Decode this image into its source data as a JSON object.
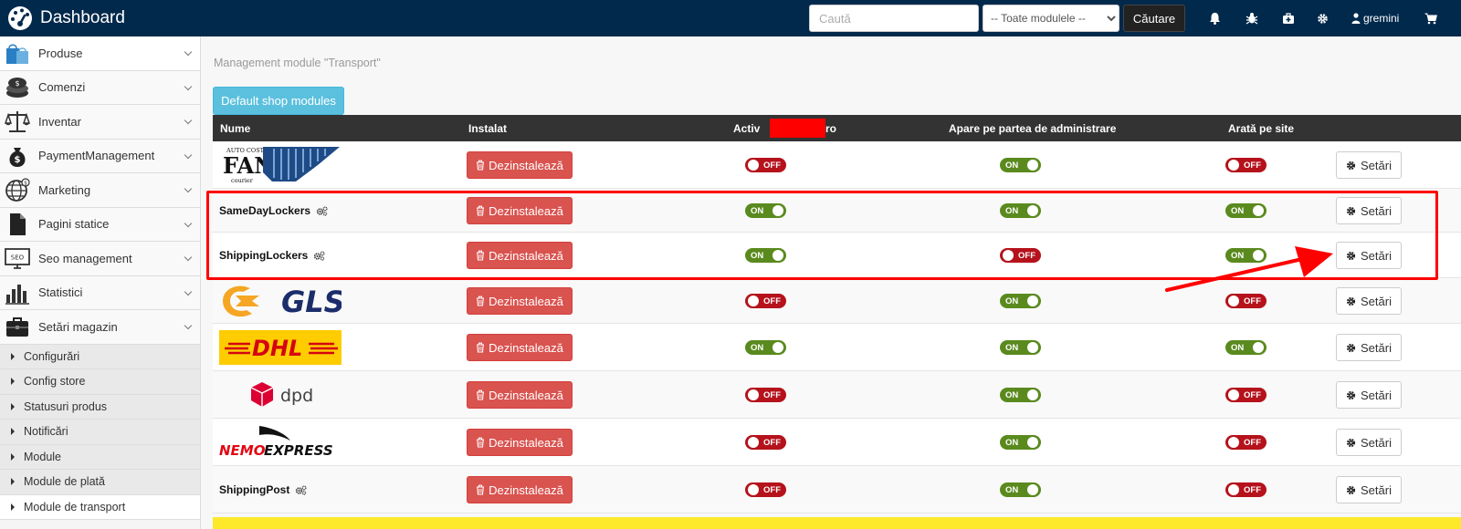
{
  "header": {
    "title": "Dashboard",
    "search_placeholder": "Caută",
    "module_select_value": "-- Toate modulele --",
    "search_button": "Căutare",
    "username": "gremini",
    "icons": [
      "bell-icon",
      "bug-icon",
      "medkit-icon",
      "gear-icon",
      "user-icon",
      "cart-icon"
    ]
  },
  "sidebar": {
    "items": [
      {
        "label": "Produse",
        "icon": "shopping-bags-icon"
      },
      {
        "label": "Comenzi",
        "icon": "coins-icon"
      },
      {
        "label": "Inventar",
        "icon": "scale-icon"
      },
      {
        "label": "PaymentManagement",
        "icon": "money-bag-icon"
      },
      {
        "label": "Marketing",
        "icon": "globe-icon"
      },
      {
        "label": "Pagini statice",
        "icon": "document-icon"
      },
      {
        "label": "Seo management",
        "icon": "seo-monitor-icon"
      },
      {
        "label": "Statistici",
        "icon": "bar-chart-icon"
      },
      {
        "label": "Setări magazin",
        "icon": "briefcase-icon"
      }
    ],
    "sub_items": [
      {
        "label": "Configurări"
      },
      {
        "label": "Config store"
      },
      {
        "label": "Statusuri produs"
      },
      {
        "label": "Notificări"
      },
      {
        "label": "Module"
      },
      {
        "label": "Module de plată"
      },
      {
        "label": "Module de transport"
      }
    ]
  },
  "main": {
    "page_title": "Management module \"Transport\"",
    "default_button": "Default shop modules",
    "columns": {
      "name": "Nume",
      "installed": "Instalat",
      "active_prefix": "Activ",
      "active_suffix": "ro",
      "admin": "Apare pe partea de administrare",
      "site": "Arată pe site"
    },
    "uninstall_label": "Dezinstalează",
    "settings_label": "Setări",
    "on_label": "ON",
    "off_label": "OFF",
    "logos": {
      "fan_top": "AUTO COST",
      "fan_main": "FAN",
      "fan_sub": "courier",
      "gls": "GLS",
      "dhl": "DHL",
      "dpd": "dpd",
      "nemo_a": "NEMO",
      "nemo_b": "EXPRESS"
    },
    "modules": [
      {
        "name": "",
        "logo": "fan-courier-logo",
        "active": false,
        "admin": true,
        "site": false
      },
      {
        "name": "SameDayLockers",
        "logo": "",
        "active": true,
        "admin": true,
        "site": true
      },
      {
        "name": "ShippingLockers",
        "logo": "",
        "active": true,
        "admin": false,
        "site": true
      },
      {
        "name": "",
        "logo": "gls-logo",
        "active": false,
        "admin": true,
        "site": false
      },
      {
        "name": "",
        "logo": "dhl-logo",
        "active": true,
        "admin": true,
        "site": true
      },
      {
        "name": "",
        "logo": "dpd-logo",
        "active": false,
        "admin": true,
        "site": false
      },
      {
        "name": "",
        "logo": "nemo-express-logo",
        "active": false,
        "admin": true,
        "site": false
      },
      {
        "name": "ShippingPost",
        "logo": "",
        "active": false,
        "admin": true,
        "site": false
      }
    ]
  },
  "colors": {
    "topbar": "#01294c",
    "danger": "#d9534f",
    "toggle_on": "#5a8a1e",
    "toggle_off": "#b5121b",
    "info": "#5bc0de",
    "highlight": "#ff0000"
  }
}
